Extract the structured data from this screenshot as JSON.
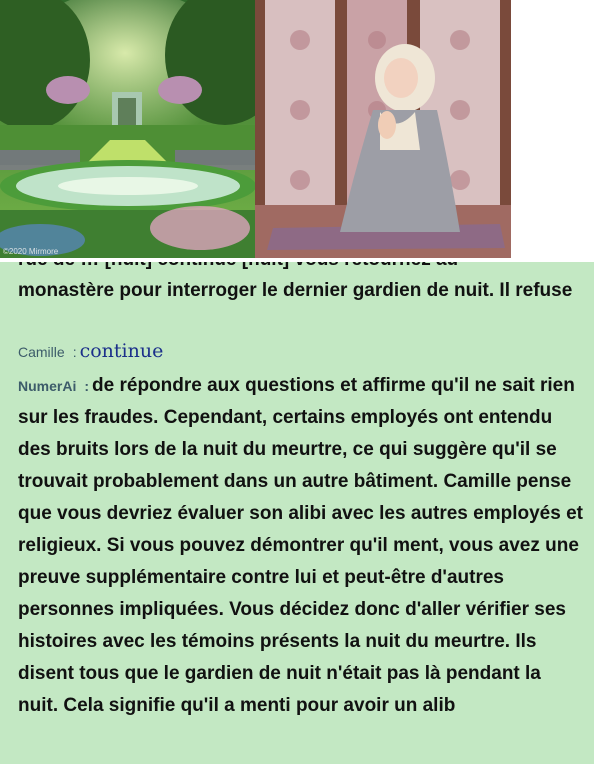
{
  "images": {
    "left": {
      "icon": "garden-image",
      "watermark": "©2020 Mirmore"
    },
    "right": {
      "icon": "praying-woman-image"
    }
  },
  "chat": {
    "partial_top": "rue de … [nuit] continue [nuit] vous retournez au",
    "messages": [
      {
        "sender": "",
        "text": "monastère pour interroger le dernier gardien de nuit. Il refuse"
      },
      {
        "sender": "Camille",
        "separator": ":",
        "text": "continue"
      },
      {
        "sender": "NumerAi",
        "separator": ":",
        "text": "de répondre aux questions et affirme qu'il ne sait rien sur les fraudes. Cependant, certains employés ont entendu des bruits lors de la nuit du meurtre, ce qui suggère qu'il se trouvait probablement dans un autre bâtiment. Camille pense que vous devriez évaluer son alibi avec les autres employés et religieux. Si vous pouvez démontrer qu'il ment, vous avez une preuve supplémentaire contre lui et peut-être d'autres personnes impliquées. Vous décidez donc d'aller vérifier ses histoires avec les témoins présents la nuit du meurtre. Ils disent tous que le gardien de nuit n'était pas là pendant la nuit. Cela signifie qu'il a menti pour avoir un alib"
      }
    ]
  },
  "colors": {
    "chat_bg": "#c3e8c3",
    "user_text": "#1b2f8a",
    "sender": "#3d5c6a"
  }
}
